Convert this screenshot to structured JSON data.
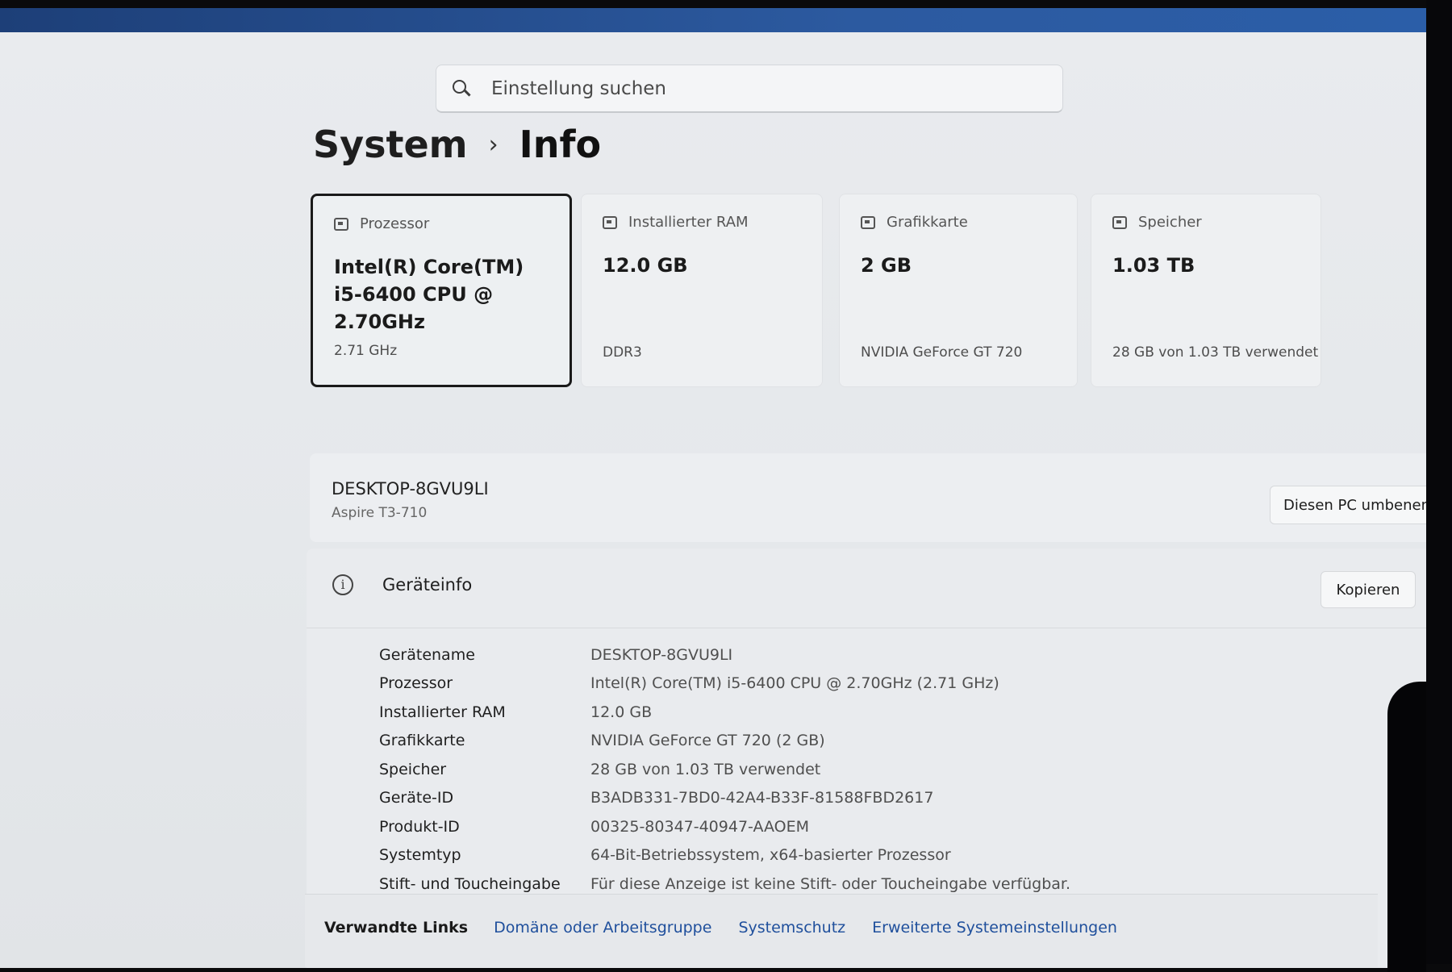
{
  "search": {
    "placeholder": "Einstellung suchen"
  },
  "breadcrumb": {
    "parent": "System",
    "separator": "›",
    "current": "Info"
  },
  "cards": [
    {
      "label": "Prozessor",
      "value": "Intel(R) Core(TM) i5-6400 CPU @ 2.70GHz",
      "sub": "2.71 GHz",
      "icon": "processor-icon"
    },
    {
      "label": "Installierter RAM",
      "value": "12.0 GB",
      "sub": "DDR3",
      "icon": "ram-icon"
    },
    {
      "label": "Grafikkarte",
      "value": "2 GB",
      "sub": "NVIDIA GeForce GT 720",
      "icon": "graphics-card-icon"
    },
    {
      "label": "Speicher",
      "value": "1.03 TB",
      "sub": "28 GB von 1.03 TB verwendet",
      "icon": "storage-icon"
    }
  ],
  "device": {
    "name": "DESKTOP-8GVU9LI",
    "model": "Aspire T3-710",
    "rename_label": "Diesen PC umbenennen"
  },
  "deviceinfo": {
    "title": "Geräteinfo",
    "copy_label": "Kopieren",
    "rows": [
      {
        "k": "Gerätename",
        "v": "DESKTOP-8GVU9LI"
      },
      {
        "k": "Prozessor",
        "v": "Intel(R) Core(TM) i5-6400 CPU @ 2.70GHz (2.71 GHz)"
      },
      {
        "k": "Installierter RAM",
        "v": "12.0 GB"
      },
      {
        "k": "Grafikkarte",
        "v": "NVIDIA GeForce GT 720 (2 GB)"
      },
      {
        "k": "Speicher",
        "v": "28 GB von 1.03 TB verwendet"
      },
      {
        "k": "Geräte-ID",
        "v": "B3ADB331-7BD0-42A4-B33F-81588FBD2617"
      },
      {
        "k": "Produkt-ID",
        "v": "00325-80347-40947-AAOEM"
      },
      {
        "k": "Systemtyp",
        "v": "64-Bit-Betriebssystem, x64-basierter Prozessor"
      },
      {
        "k": "Stift- und Toucheingabe",
        "v": "Für diese Anzeige ist keine Stift- oder Toucheingabe verfügbar."
      }
    ]
  },
  "related": {
    "label": "Verwandte Links",
    "links": [
      "Domäne oder Arbeitsgruppe",
      "Systemschutz",
      "Erweiterte Systemeinstellungen"
    ]
  }
}
